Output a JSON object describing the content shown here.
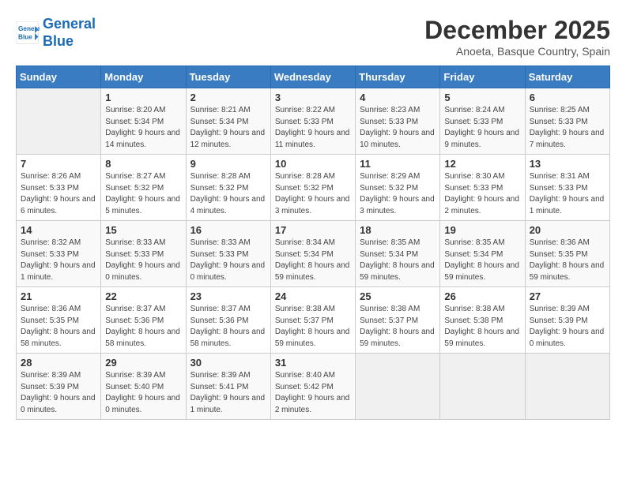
{
  "header": {
    "logo_line1": "General",
    "logo_line2": "Blue",
    "month": "December 2025",
    "location": "Anoeta, Basque Country, Spain"
  },
  "weekdays": [
    "Sunday",
    "Monday",
    "Tuesday",
    "Wednesday",
    "Thursday",
    "Friday",
    "Saturday"
  ],
  "weeks": [
    [
      {
        "day": "",
        "sunrise": "",
        "sunset": "",
        "daylight": ""
      },
      {
        "day": "1",
        "sunrise": "Sunrise: 8:20 AM",
        "sunset": "Sunset: 5:34 PM",
        "daylight": "Daylight: 9 hours and 14 minutes."
      },
      {
        "day": "2",
        "sunrise": "Sunrise: 8:21 AM",
        "sunset": "Sunset: 5:34 PM",
        "daylight": "Daylight: 9 hours and 12 minutes."
      },
      {
        "day": "3",
        "sunrise": "Sunrise: 8:22 AM",
        "sunset": "Sunset: 5:33 PM",
        "daylight": "Daylight: 9 hours and 11 minutes."
      },
      {
        "day": "4",
        "sunrise": "Sunrise: 8:23 AM",
        "sunset": "Sunset: 5:33 PM",
        "daylight": "Daylight: 9 hours and 10 minutes."
      },
      {
        "day": "5",
        "sunrise": "Sunrise: 8:24 AM",
        "sunset": "Sunset: 5:33 PM",
        "daylight": "Daylight: 9 hours and 9 minutes."
      },
      {
        "day": "6",
        "sunrise": "Sunrise: 8:25 AM",
        "sunset": "Sunset: 5:33 PM",
        "daylight": "Daylight: 9 hours and 7 minutes."
      }
    ],
    [
      {
        "day": "7",
        "sunrise": "Sunrise: 8:26 AM",
        "sunset": "Sunset: 5:33 PM",
        "daylight": "Daylight: 9 hours and 6 minutes."
      },
      {
        "day": "8",
        "sunrise": "Sunrise: 8:27 AM",
        "sunset": "Sunset: 5:32 PM",
        "daylight": "Daylight: 9 hours and 5 minutes."
      },
      {
        "day": "9",
        "sunrise": "Sunrise: 8:28 AM",
        "sunset": "Sunset: 5:32 PM",
        "daylight": "Daylight: 9 hours and 4 minutes."
      },
      {
        "day": "10",
        "sunrise": "Sunrise: 8:28 AM",
        "sunset": "Sunset: 5:32 PM",
        "daylight": "Daylight: 9 hours and 3 minutes."
      },
      {
        "day": "11",
        "sunrise": "Sunrise: 8:29 AM",
        "sunset": "Sunset: 5:32 PM",
        "daylight": "Daylight: 9 hours and 3 minutes."
      },
      {
        "day": "12",
        "sunrise": "Sunrise: 8:30 AM",
        "sunset": "Sunset: 5:33 PM",
        "daylight": "Daylight: 9 hours and 2 minutes."
      },
      {
        "day": "13",
        "sunrise": "Sunrise: 8:31 AM",
        "sunset": "Sunset: 5:33 PM",
        "daylight": "Daylight: 9 hours and 1 minute."
      }
    ],
    [
      {
        "day": "14",
        "sunrise": "Sunrise: 8:32 AM",
        "sunset": "Sunset: 5:33 PM",
        "daylight": "Daylight: 9 hours and 1 minute."
      },
      {
        "day": "15",
        "sunrise": "Sunrise: 8:33 AM",
        "sunset": "Sunset: 5:33 PM",
        "daylight": "Daylight: 9 hours and 0 minutes."
      },
      {
        "day": "16",
        "sunrise": "Sunrise: 8:33 AM",
        "sunset": "Sunset: 5:33 PM",
        "daylight": "Daylight: 9 hours and 0 minutes."
      },
      {
        "day": "17",
        "sunrise": "Sunrise: 8:34 AM",
        "sunset": "Sunset: 5:34 PM",
        "daylight": "Daylight: 8 hours and 59 minutes."
      },
      {
        "day": "18",
        "sunrise": "Sunrise: 8:35 AM",
        "sunset": "Sunset: 5:34 PM",
        "daylight": "Daylight: 8 hours and 59 minutes."
      },
      {
        "day": "19",
        "sunrise": "Sunrise: 8:35 AM",
        "sunset": "Sunset: 5:34 PM",
        "daylight": "Daylight: 8 hours and 59 minutes."
      },
      {
        "day": "20",
        "sunrise": "Sunrise: 8:36 AM",
        "sunset": "Sunset: 5:35 PM",
        "daylight": "Daylight: 8 hours and 59 minutes."
      }
    ],
    [
      {
        "day": "21",
        "sunrise": "Sunrise: 8:36 AM",
        "sunset": "Sunset: 5:35 PM",
        "daylight": "Daylight: 8 hours and 58 minutes."
      },
      {
        "day": "22",
        "sunrise": "Sunrise: 8:37 AM",
        "sunset": "Sunset: 5:36 PM",
        "daylight": "Daylight: 8 hours and 58 minutes."
      },
      {
        "day": "23",
        "sunrise": "Sunrise: 8:37 AM",
        "sunset": "Sunset: 5:36 PM",
        "daylight": "Daylight: 8 hours and 58 minutes."
      },
      {
        "day": "24",
        "sunrise": "Sunrise: 8:38 AM",
        "sunset": "Sunset: 5:37 PM",
        "daylight": "Daylight: 8 hours and 59 minutes."
      },
      {
        "day": "25",
        "sunrise": "Sunrise: 8:38 AM",
        "sunset": "Sunset: 5:37 PM",
        "daylight": "Daylight: 8 hours and 59 minutes."
      },
      {
        "day": "26",
        "sunrise": "Sunrise: 8:38 AM",
        "sunset": "Sunset: 5:38 PM",
        "daylight": "Daylight: 8 hours and 59 minutes."
      },
      {
        "day": "27",
        "sunrise": "Sunrise: 8:39 AM",
        "sunset": "Sunset: 5:39 PM",
        "daylight": "Daylight: 9 hours and 0 minutes."
      }
    ],
    [
      {
        "day": "28",
        "sunrise": "Sunrise: 8:39 AM",
        "sunset": "Sunset: 5:39 PM",
        "daylight": "Daylight: 9 hours and 0 minutes."
      },
      {
        "day": "29",
        "sunrise": "Sunrise: 8:39 AM",
        "sunset": "Sunset: 5:40 PM",
        "daylight": "Daylight: 9 hours and 0 minutes."
      },
      {
        "day": "30",
        "sunrise": "Sunrise: 8:39 AM",
        "sunset": "Sunset: 5:41 PM",
        "daylight": "Daylight: 9 hours and 1 minute."
      },
      {
        "day": "31",
        "sunrise": "Sunrise: 8:40 AM",
        "sunset": "Sunset: 5:42 PM",
        "daylight": "Daylight: 9 hours and 2 minutes."
      },
      {
        "day": "",
        "sunrise": "",
        "sunset": "",
        "daylight": ""
      },
      {
        "day": "",
        "sunrise": "",
        "sunset": "",
        "daylight": ""
      },
      {
        "day": "",
        "sunrise": "",
        "sunset": "",
        "daylight": ""
      }
    ]
  ]
}
